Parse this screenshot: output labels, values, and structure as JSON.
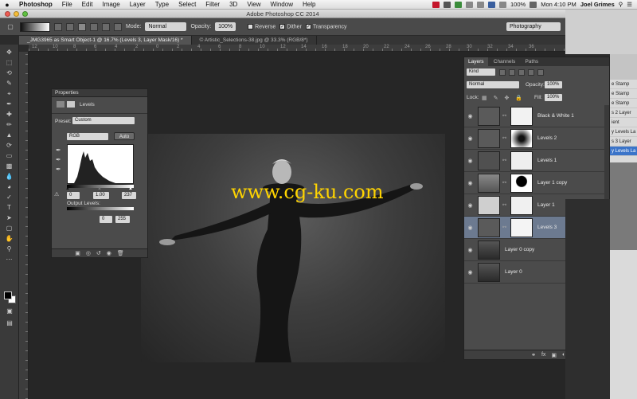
{
  "menubar": {
    "apple": "",
    "items": [
      "Photoshop",
      "File",
      "Edit",
      "Image",
      "Layer",
      "Type",
      "Select",
      "Filter",
      "3D",
      "View",
      "Window",
      "Help"
    ],
    "battery": "100%",
    "clock": "Mon 4:10 PM",
    "user": "Joel Grimes"
  },
  "window": {
    "title": "Adobe Photoshop CC 2014"
  },
  "options": {
    "mode_label": "Mode:",
    "mode_value": "Normal",
    "opacity_label": "Opacity:",
    "opacity_value": "100%",
    "reverse": "Reverse",
    "dither": "Dither",
    "transparency": "Transparency",
    "workspace": "Photography"
  },
  "tabs": [
    {
      "label": "_JMG3965 as Smart Object-1 @ 16.7% (Levels 3, Layer Mask/16) *"
    },
    {
      "label": "© Artistic_Selections-38.jpg @ 33.3% (RGB/8*)"
    }
  ],
  "ruler": {
    "h_ticks": [
      "12",
      "10",
      "8",
      "6",
      "4",
      "2",
      "0",
      "2",
      "4",
      "6",
      "8",
      "10",
      "12",
      "14",
      "16",
      "18",
      "20",
      "22",
      "24",
      "26",
      "28",
      "30",
      "32",
      "34",
      "36"
    ]
  },
  "tools": [
    "move-tool-icon",
    "marquee-tool-icon",
    "lasso-tool-icon",
    "quick-select-tool-icon",
    "crop-tool-icon",
    "eyedropper-tool-icon",
    "healing-brush-icon",
    "brush-tool-icon",
    "clone-stamp-icon",
    "history-brush-icon",
    "eraser-tool-icon",
    "gradient-tool-icon",
    "blur-tool-icon",
    "dodge-tool-icon",
    "pen-tool-icon",
    "type-tool-icon",
    "path-select-icon",
    "shape-tool-icon",
    "hand-tool-icon",
    "zoom-tool-icon"
  ],
  "properties": {
    "title": "Properties",
    "panel": "Levels",
    "preset_label": "Preset:",
    "preset_value": "Custom",
    "channel": "RGB",
    "auto": "Auto",
    "input_black": "0",
    "input_gamma": "1.00",
    "input_white": "237",
    "output_label": "Output Levels:",
    "output_black": "0",
    "output_white": "255"
  },
  "watermark": "www.cg-ku.com",
  "layers_panel": {
    "tabs": [
      "Layers",
      "Channels",
      "Paths"
    ],
    "filter": "Kind",
    "blend": "Normal",
    "opacity_label": "Opacity:",
    "opacity": "100%",
    "lock_label": "Lock:",
    "fill_label": "Fill:",
    "fill": "100%",
    "layers": [
      {
        "name": "Black & White 1",
        "thumb": "adj",
        "mask": "#f2f2f2",
        "selected": false
      },
      {
        "name": "Levels 2",
        "thumb": "adj",
        "mask": "radial",
        "selected": false
      },
      {
        "name": "Levels 1",
        "thumb": "adj-dark",
        "mask": "#eeeeee",
        "selected": false
      },
      {
        "name": "Layer 1 copy",
        "thumb": "photo-gray",
        "mask": "silhouette",
        "selected": false
      },
      {
        "name": "Layer 1",
        "thumb": "photo-light",
        "mask": "#f0f0f0",
        "selected": false
      },
      {
        "name": "Levels 3",
        "thumb": "adj",
        "mask": "#f4f4f4",
        "selected": true
      },
      {
        "name": "Layer 0 copy",
        "thumb": "photo-dark",
        "mask": "",
        "selected": false
      },
      {
        "name": "Layer 0",
        "thumb": "photo-dark",
        "mask": "",
        "selected": false
      }
    ]
  },
  "history": {
    "items": [
      {
        "label": "e Stamp",
        "selected": false
      },
      {
        "label": "e Stamp",
        "selected": false
      },
      {
        "label": "e Stamp",
        "selected": false
      },
      {
        "label": "s 2 Layer",
        "selected": false
      },
      {
        "label": "ient",
        "selected": false
      },
      {
        "label": "y Levels La",
        "selected": false
      },
      {
        "label": "s 3 Layer",
        "selected": false
      },
      {
        "label": "y Levels La",
        "selected": true
      }
    ]
  }
}
